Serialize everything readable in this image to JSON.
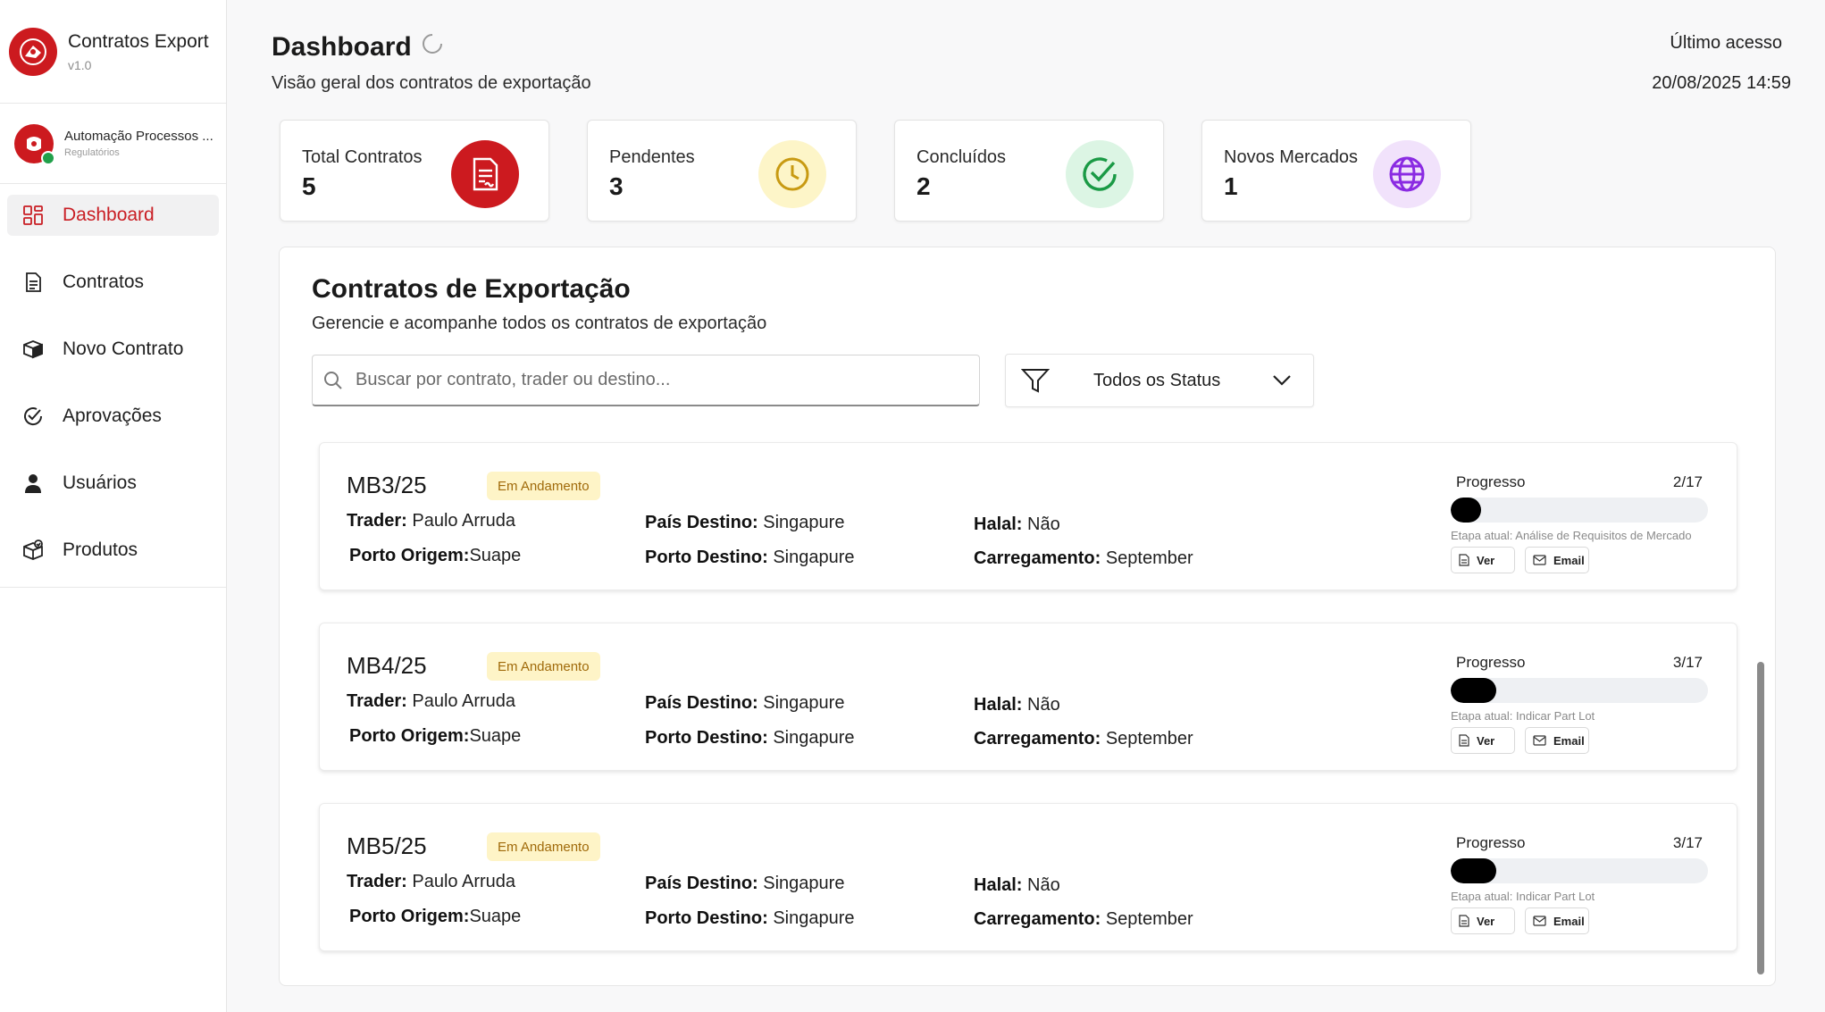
{
  "brand": {
    "title": "Contratos Export",
    "version": "v1.0"
  },
  "org": {
    "name": "Automação Processos ...",
    "sub": "Regulatórios"
  },
  "nav": [
    {
      "label": "Dashboard",
      "icon": "dashboard-grid-icon",
      "active": true
    },
    {
      "label": "Contratos",
      "icon": "document-icon"
    },
    {
      "label": "Novo Contrato",
      "icon": "box-icon"
    },
    {
      "label": "Aprovações",
      "icon": "check-circle-icon"
    },
    {
      "label": "Usuários",
      "icon": "user-icon"
    },
    {
      "label": "Produtos",
      "icon": "package-icon"
    }
  ],
  "header": {
    "title": "Dashboard",
    "subtitle": "Visão geral dos contratos de exportação",
    "last_access_label": "Último acesso",
    "last_access_value": "20/08/2025 14:59"
  },
  "stats": [
    {
      "label": "Total Contratos",
      "value": "5",
      "icon": "contract-icon",
      "color": "#cc1a1f",
      "bg": "#cc1a1f"
    },
    {
      "label": "Pendentes",
      "value": "3",
      "icon": "clock-icon",
      "color": "#c89a12",
      "bg": "#fdf5c8"
    },
    {
      "label": "Concluídos",
      "value": "2",
      "icon": "check-circle-icon",
      "color": "#1a9a45",
      "bg": "#dcf5e4"
    },
    {
      "label": "Novos Mercados",
      "value": "1",
      "icon": "globe-icon",
      "color": "#8a2be2",
      "bg": "#f1e2fb"
    }
  ],
  "contracts_panel": {
    "title": "Contratos de Exportação",
    "subtitle": "Gerencie e acompanhe todos os contratos de exportação",
    "search_placeholder": "Buscar por contrato, trader ou destino...",
    "filter_value": "Todos os Status"
  },
  "labels": {
    "trader": "Trader:",
    "porto_origem": "Porto Origem:",
    "pais_destino": "País Destino:",
    "porto_destino": "Porto Destino:",
    "halal": "Halal:",
    "carregamento": "Carregamento:",
    "progresso": "Progresso",
    "ver": "Ver",
    "email": "Email"
  },
  "contracts": [
    {
      "id": "MB3/25",
      "status": "Em Andamento",
      "trader": "Paulo Arruda",
      "porto_origem": "Suape",
      "pais_destino": "Singapure",
      "porto_destino": "Singapure",
      "halal": "Não",
      "carregamento": "September",
      "progress_text": "2/17",
      "progress": 0.1176,
      "stage": "Etapa atual: Análise de Requisitos de Mercado"
    },
    {
      "id": "MB4/25",
      "status": "Em Andamento",
      "trader": "Paulo Arruda",
      "porto_origem": "Suape",
      "pais_destino": "Singapure",
      "porto_destino": "Singapure",
      "halal": "Não",
      "carregamento": "September",
      "progress_text": "3/17",
      "progress": 0.1765,
      "stage": "Etapa atual: Indicar Part Lot"
    },
    {
      "id": "MB5/25",
      "status": "Em Andamento",
      "trader": "Paulo Arruda",
      "porto_origem": "Suape",
      "pais_destino": "Singapure",
      "porto_destino": "Singapure",
      "halal": "Não",
      "carregamento": "September",
      "progress_text": "3/17",
      "progress": 0.1765,
      "stage": "Etapa atual: Indicar Part Lot"
    }
  ]
}
